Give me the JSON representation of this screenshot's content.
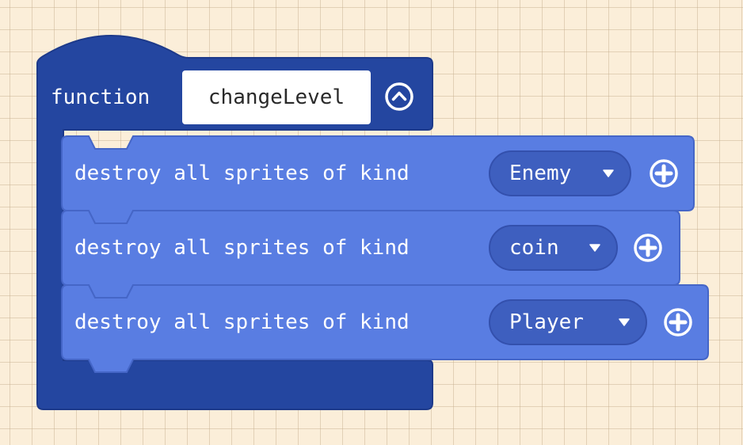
{
  "function_block": {
    "keyword": "function",
    "name": "changeLevel",
    "collapse_icon": "chevron-up-circle-icon",
    "colors": {
      "outer": "#2446a0",
      "inner": "#597de2",
      "dropdown": "#3e5fbf",
      "background": "#fbeed9"
    }
  },
  "statements": [
    {
      "label": "destroy all sprites of kind",
      "kind": "Enemy",
      "add_icon": "plus-circle-icon"
    },
    {
      "label": "destroy all sprites of kind",
      "kind": "coin",
      "add_icon": "plus-circle-icon"
    },
    {
      "label": "destroy all sprites of kind",
      "kind": "Player",
      "add_icon": "plus-circle-icon"
    }
  ]
}
